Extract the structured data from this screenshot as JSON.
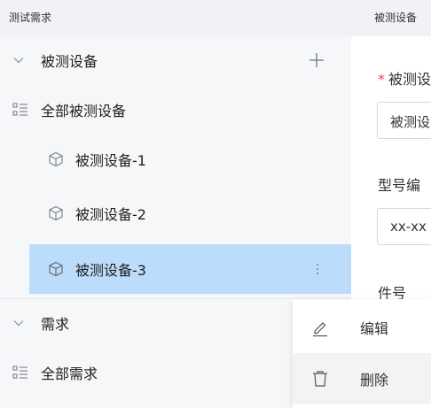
{
  "left_panel": {
    "header": "测试需求",
    "groups": [
      {
        "title": "被测设备",
        "all_label": "全部被测设备",
        "items": [
          "被测设备-1",
          "被测设备-2",
          "被测设备-3"
        ]
      },
      {
        "title": "需求",
        "all_label": "全部需求"
      }
    ]
  },
  "right_panel": {
    "header": "被测设备",
    "fields": [
      {
        "label": "被测设",
        "required": "*",
        "value": "被测设"
      },
      {
        "label": "型号编",
        "value": "xx-xx"
      },
      {
        "label": "件号"
      }
    ]
  },
  "context_menu": {
    "items": [
      "编辑",
      "删除"
    ]
  },
  "colors": {
    "selected_bg": "#bcdcfb",
    "panel_bg": "#f6f7f9",
    "required": "#e34d59"
  }
}
